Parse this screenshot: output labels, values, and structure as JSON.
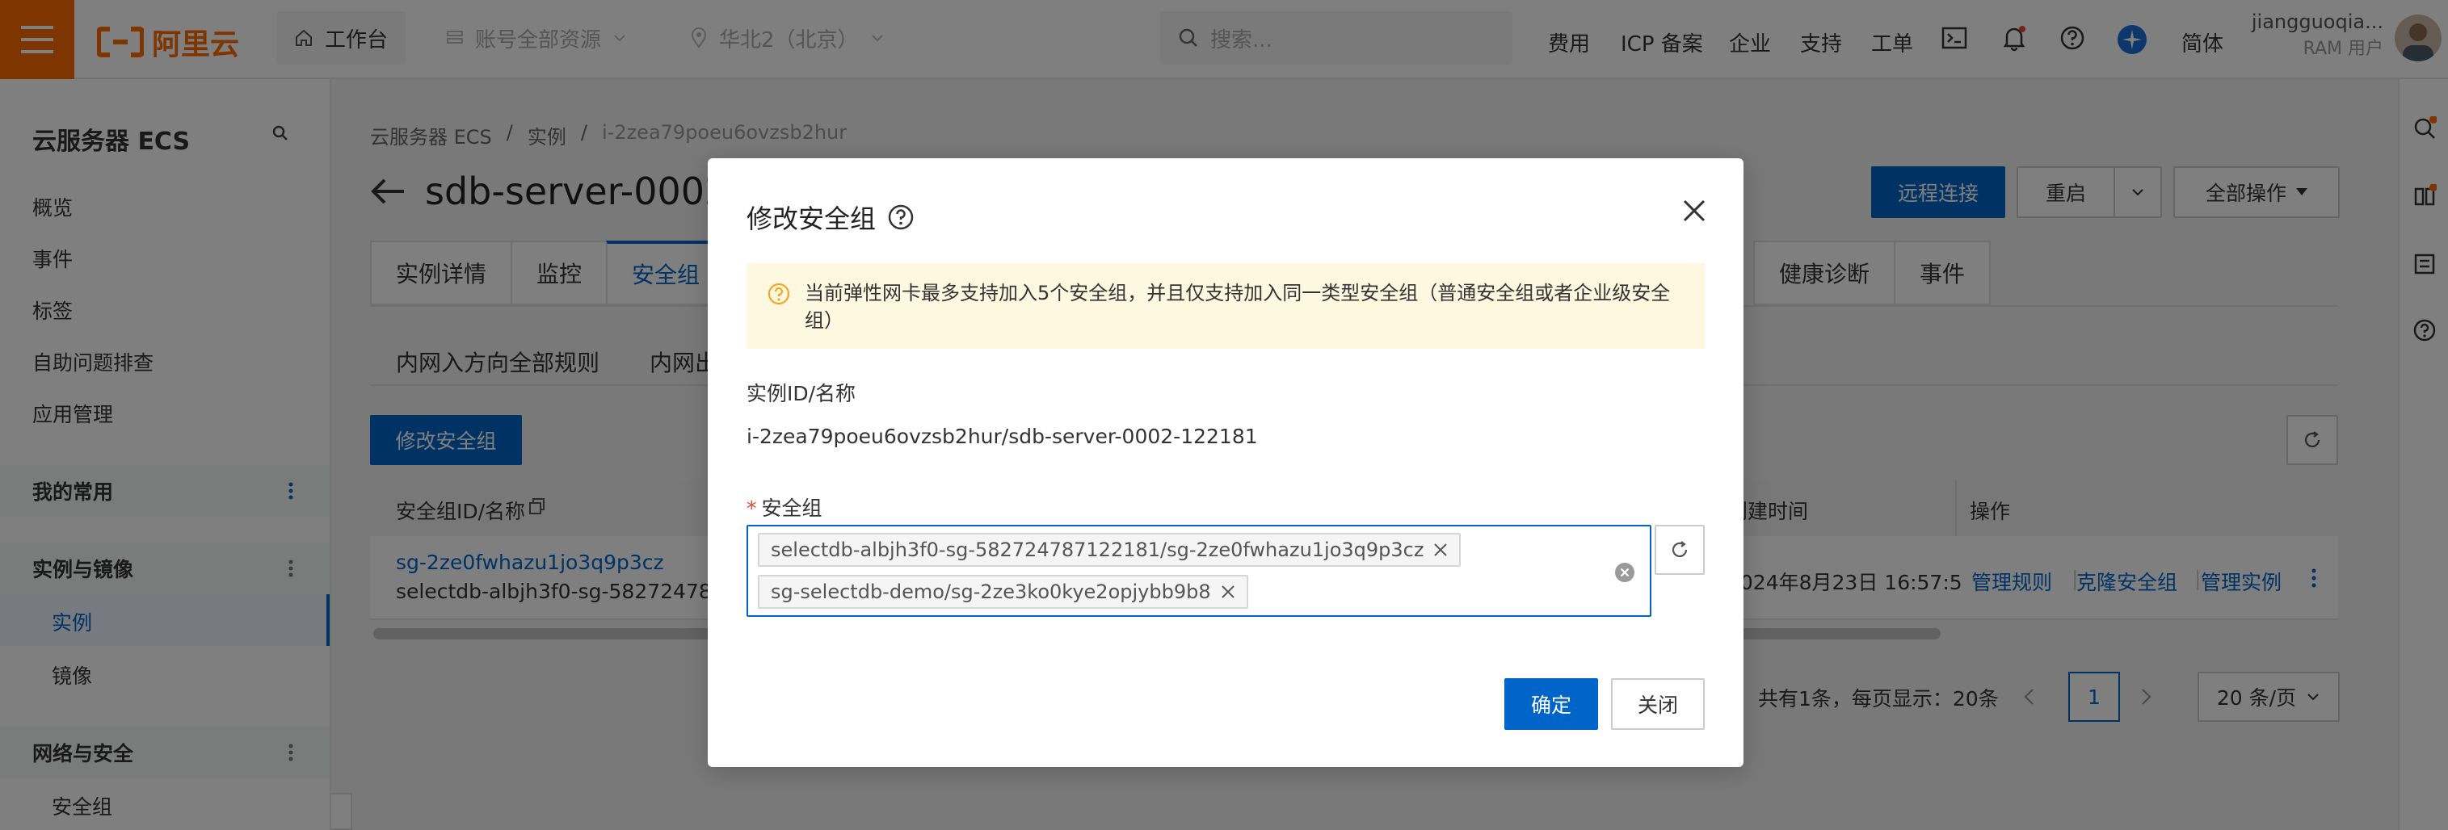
{
  "topbar": {
    "brand": "阿里云",
    "workbench": "工作台",
    "resource_scope": "账号全部资源",
    "region": "华北2（北京）",
    "search_placeholder": "搜索...",
    "links": [
      "费用",
      "ICP 备案",
      "企业",
      "支持",
      "工单"
    ],
    "language": "简体",
    "username": "jiangguoqia...",
    "user_role": "RAM 用户",
    "accent_color": "#ff6a00"
  },
  "sidebar": {
    "title": "云服务器 ECS",
    "items": [
      "概览",
      "事件",
      "标签",
      "自助问题排查",
      "应用管理"
    ],
    "groups": [
      {
        "label": "我的常用"
      },
      {
        "label": "实例与镜像",
        "children": [
          "实例",
          "镜像"
        ]
      },
      {
        "label": "网络与安全",
        "children": [
          "安全组"
        ]
      }
    ]
  },
  "breadcrumb": [
    "云服务器 ECS",
    "实例",
    "i-2zea79poeu6ovzsb2hur"
  ],
  "page": {
    "title": "sdb-server-0002",
    "remote_connect": "远程连接",
    "restart": "重启",
    "all_actions": "全部操作"
  },
  "tabs": [
    "实例详情",
    "监控",
    "安全组"
  ],
  "tabs_right": [
    "健康诊断",
    "事件"
  ],
  "subtabs": [
    "内网入方向全部规则",
    "内网出"
  ],
  "modify_sg_button": "修改安全组",
  "table": {
    "headers": {
      "sg": "安全组ID/名称",
      "created": "创建时间",
      "ops": "操作"
    },
    "row": {
      "sg_id": "sg-2ze0fwhazu1jo3q9p3cz",
      "sg_name": "selectdb-albjh3f0-sg-58272478...",
      "created": "2024年8月23日 16:57:5",
      "actions": [
        "管理规则",
        "克隆安全组",
        "管理实例"
      ]
    }
  },
  "pagination": {
    "summary": "共有1条，每页显示：20条",
    "current_page": "1",
    "page_size": "20 条/页"
  },
  "modal": {
    "title": "修改安全组",
    "notice": "当前弹性网卡最多支持加入5个安全组，并且仅支持加入同一类型安全组（普通安全组或者企业级安全组）",
    "instance_label": "实例ID/名称",
    "instance_value": "i-2zea79poeu6ovzsb2hur/sdb-server-0002-122181",
    "sg_label": "安全组",
    "selected_groups": [
      "selectdb-albjh3f0-sg-582724787122181/sg-2ze0fwhazu1jo3q9p3cz",
      "sg-selectdb-demo/sg-2ze3ko0kye2opjybb9b8"
    ],
    "confirm": "确定",
    "close": "关闭"
  }
}
